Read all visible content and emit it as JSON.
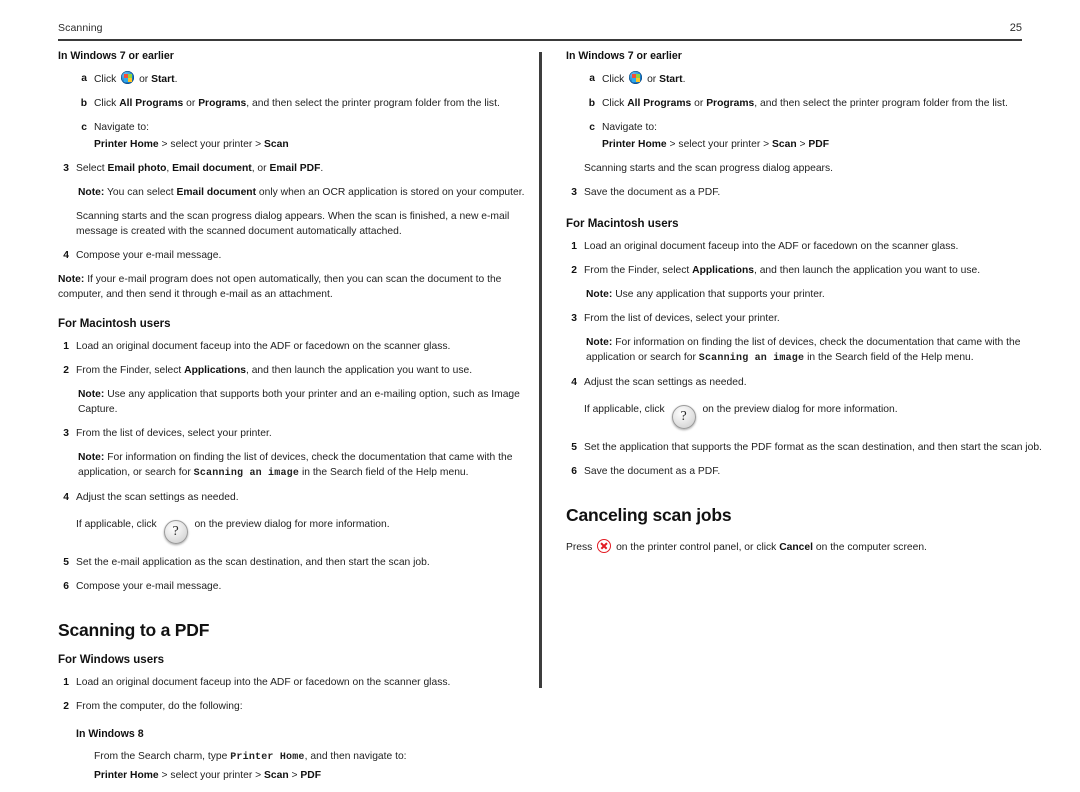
{
  "header": {
    "chapter": "Scanning",
    "page_number": "25"
  },
  "icons": {
    "windows_orb": "windows-logo-icon",
    "help": "help-question-icon",
    "cancel": "cancel-x-icon"
  },
  "left_column": {
    "win7_heading": "In Windows 7 or earlier",
    "step_a_marker": "a",
    "step_a_pre": "Click",
    "step_a_mid": "or",
    "step_a_bold": "Start",
    "step_a_post": ".",
    "step_b_marker": "b",
    "step_b_pre": "Click",
    "step_b_bold1": "All Programs",
    "step_b_mid": "or",
    "step_b_bold2": "Programs",
    "step_b_post": ", and then select the printer program folder from the list.",
    "step_c_marker": "c",
    "step_c_text": "Navigate to:",
    "step_c_crumb_1": "Printer Home",
    "step_c_crumb_2": "> select your printer >",
    "step_c_crumb_3": "Scan",
    "step3_marker": "3",
    "step3_pre": "Select",
    "step3_bold1": "Email photo",
    "step3_sep1": ",",
    "step3_bold2": "Email document",
    "step3_sep2": ", or",
    "step3_bold3": "Email PDF",
    "step3_post": ".",
    "note1_label": "Note:",
    "note1_pre": "You can select",
    "note1_bold": "Email document",
    "note1_post": "only when an OCR application is stored on your computer.",
    "scan_starts": "Scanning starts and the scan progress dialog appears. When the scan is finished, a new e-mail message is created with the scanned document automatically attached.",
    "step4_marker": "4",
    "step4_text": "Compose your e-mail message.",
    "note2_label": "Note:",
    "note2_text": "If your e-mail program does not open automatically, then you can scan the document to the computer, and then send it through e-mail as an attachment.",
    "mac_heading": "For Macintosh users",
    "mac_step1_marker": "1",
    "mac_step1_text": "Load an original document faceup into the ADF or facedown on the scanner glass.",
    "mac_step2_marker": "2",
    "mac_step2_pre": "From the Finder, select",
    "mac_step2_bold": "Applications",
    "mac_step2_post": ", and then launch the application you want to use.",
    "mac_note1_label": "Note:",
    "mac_note1_text": "Use any application that supports both your printer and an e-mailing option, such as Image Capture.",
    "mac_step3_marker": "3",
    "mac_step3_text": "From the list of devices, select your printer.",
    "mac_note2_label": "Note:",
    "mac_note2_pre": "For information on finding the list of devices, check the documentation that came with the application, or search for",
    "mac_note2_mono": "Scanning an image",
    "mac_note2_post": "in the Search field of the Help menu.",
    "mac_step4_marker": "4",
    "mac_step4_text": "Adjust the scan settings as needed.",
    "mac_help_pre": "If applicable, click",
    "mac_help_post": "on the preview dialog for more information.",
    "mac_step5_marker": "5",
    "mac_step5_text": "Set the e-mail application as the scan destination, and then start the scan job.",
    "mac_step6_marker": "6",
    "mac_step6_text": "Compose your e-mail message.",
    "pdf_title": "Scanning to a PDF",
    "win_heading": "For Windows users",
    "win_step1_marker": "1",
    "win_step1_text": "Load an original document faceup into the ADF or facedown on the scanner glass.",
    "win_step2_marker": "2",
    "win_step2_text": "From the computer, do the following:",
    "win8_heading": "In Windows 8",
    "win8_pre": "From the Search charm, type",
    "win8_mono": "Printer Home",
    "win8_post": ", and then navigate to:",
    "win8_crumb_1": "Printer Home",
    "win8_crumb_2": "> select your printer >",
    "win8_crumb_3": "Scan",
    "win8_crumb_4": ">",
    "win8_crumb_5": "PDF"
  },
  "right_column": {
    "win7_heading": "In Windows 7 or earlier",
    "step_a_marker": "a",
    "step_a_pre": "Click",
    "step_a_mid": "or",
    "step_a_bold": "Start",
    "step_a_post": ".",
    "step_b_marker": "b",
    "step_b_pre": "Click",
    "step_b_bold1": "All Programs",
    "step_b_mid": "or",
    "step_b_bold2": "Programs",
    "step_b_post": ", and then select the printer program folder from the list.",
    "step_c_marker": "c",
    "step_c_text": "Navigate to:",
    "step_c_crumb_1": "Printer Home",
    "step_c_crumb_2": "> select your printer >",
    "step_c_crumb_3": "Scan",
    "step_c_crumb_4": ">",
    "step_c_crumb_5": "PDF",
    "scan_starts": "Scanning starts and the scan progress dialog appears.",
    "step3_marker": "3",
    "step3_text": "Save the document as a PDF.",
    "mac_heading": "For Macintosh users",
    "mac_step1_marker": "1",
    "mac_step1_text": "Load an original document faceup into the ADF or facedown on the scanner glass.",
    "mac_step2_marker": "2",
    "mac_step2_pre": "From the Finder, select",
    "mac_step2_bold": "Applications",
    "mac_step2_post": ", and then launch the application you want to use.",
    "mac_note1_label": "Note:",
    "mac_note1_text": "Use any application that supports your printer.",
    "mac_step3_marker": "3",
    "mac_step3_text": "From the list of devices, select your printer.",
    "mac_note2_label": "Note:",
    "mac_note2_pre": "For information on finding the list of devices, check the documentation that came with the application or search for",
    "mac_note2_mono": "Scanning an image",
    "mac_note2_post": "in the Search field of the Help menu.",
    "mac_step4_marker": "4",
    "mac_step4_text": "Adjust the scan settings as needed.",
    "mac_help_pre": "If applicable, click",
    "mac_help_post": "on the preview dialog for more information.",
    "mac_step5_marker": "5",
    "mac_step5_text": "Set the application that supports the PDF format as the scan destination, and then start the scan job.",
    "mac_step6_marker": "6",
    "mac_step6_text": "Save the document as a PDF.",
    "cancel_title": "Canceling scan jobs",
    "cancel_pre": "Press",
    "cancel_mid": "on the printer control panel, or click",
    "cancel_bold": "Cancel",
    "cancel_post": "on the computer screen."
  }
}
